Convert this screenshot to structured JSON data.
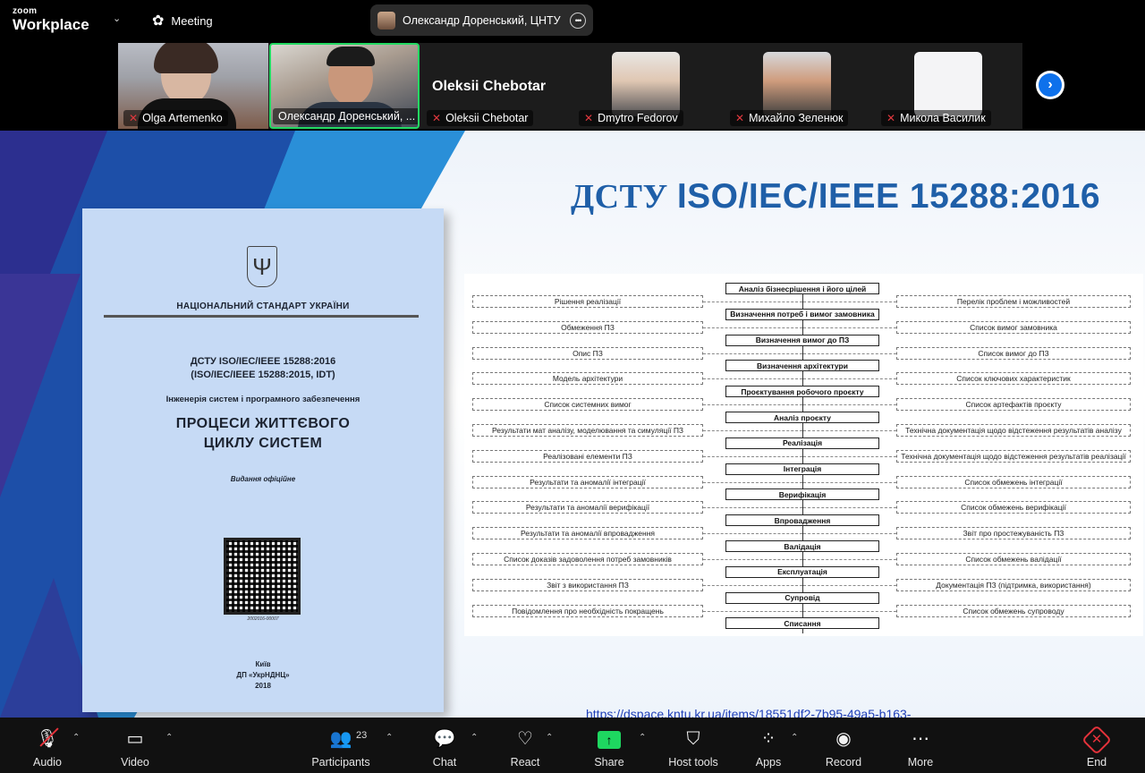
{
  "app": {
    "logo_top": "zoom",
    "logo_bottom": "Workplace",
    "meeting_label": "Meeting"
  },
  "active_speaker": {
    "name": "Олександр Доренський, ЦНТУ"
  },
  "participants_strip": [
    {
      "name": "Olga Artemenko",
      "muted": true
    },
    {
      "name": "Олександр Доренський, ...",
      "muted": false
    },
    {
      "name": "Oleksii Chebotar",
      "display_name": "Oleksii Chebotar",
      "muted": true
    },
    {
      "name": "Dmytro Fedorov",
      "muted": true
    },
    {
      "name": "Михайло Зеленюк",
      "muted": true
    },
    {
      "name": "Микола Василик",
      "muted": true
    }
  ],
  "icons": {
    "mute": "mic-off-icon",
    "next": "chevron-right-icon",
    "paw": "paw-icon"
  },
  "slide": {
    "title_prefix": "ДСТУ ",
    "title_main": "ISO/IEC/IEEE 15288:2016",
    "link": "https://dspace.kntu.kr.ua/items/18551df2-7b95-49a5-b163-",
    "document": {
      "standard_label": "НАЦІОНАЛЬНИЙ СТАНДАРТ УКРАЇНИ",
      "code_line1": "ДСТУ ISO/IEC/IEEE 15288:2016",
      "code_line2": "(ISO/IEC/IEEE 15288:2015, IDT)",
      "subtitle": "Інженерія систем і програмного забезпечення",
      "big_line1": "ПРОЦЕСИ ЖИТТЄВОГО",
      "big_line2": "ЦИКЛУ СИСТЕМ",
      "edition": "Видання офіційне",
      "qr_caption": "2002016-00007",
      "imprint_city": "Київ",
      "imprint_org": "ДП «УкрНДНЦ»",
      "imprint_year": "2018"
    },
    "flow": {
      "processes": [
        "Аналіз бізнесрішення і його цілей",
        "Визначення потреб і вимог замовника",
        "Визначення вимог до ПЗ",
        "Визначення архітектури",
        "Проєктування робочого проєкту",
        "Аналіз проєкту",
        "Реалізація",
        "Інтеграція",
        "Верифікація",
        "Впровадження",
        "Валідація",
        "Експлуатація",
        "Супровід",
        "Списання"
      ],
      "left_outputs": [
        "Рішення реалізації",
        "Обмеження ПЗ",
        "Опис ПЗ",
        "Модель архітектури",
        "Список системних вимог",
        "Результати мат аналізу, моделювання та симуляції ПЗ",
        "Реалізовані елементи ПЗ",
        "Результати та аномалії інтеграції",
        "Результати та аномалії верифікації",
        "Результати та аномалії впровадження",
        "Список доказів задоволення потреб замовників",
        "Звіт з використання ПЗ",
        "Повідомлення про необхідність покращень"
      ],
      "right_outputs": [
        "Перелік проблем і можливостей",
        "Список вимог замовника",
        "Список вимог до ПЗ",
        "Список ключових характеристик",
        "Список артефактів проєкту",
        "Технічна документація щодо відстеження результатів аналізу",
        "Технічна документація щодо відстеження результатів реалізації",
        "Список обмежень інтеграції",
        "Список обмежень верифікації",
        "Звіт про простежуваність ПЗ",
        "Список обмежень валідації",
        "Документація ПЗ (підтримка, використання)",
        "Список обмежень супроводу"
      ]
    }
  },
  "toolbar": {
    "audio": "Audio",
    "video": "Video",
    "participants": "Participants",
    "participants_count": "23",
    "chat": "Chat",
    "react": "React",
    "share": "Share",
    "host_tools": "Host tools",
    "apps": "Apps",
    "record": "Record",
    "more": "More",
    "end": "End"
  }
}
